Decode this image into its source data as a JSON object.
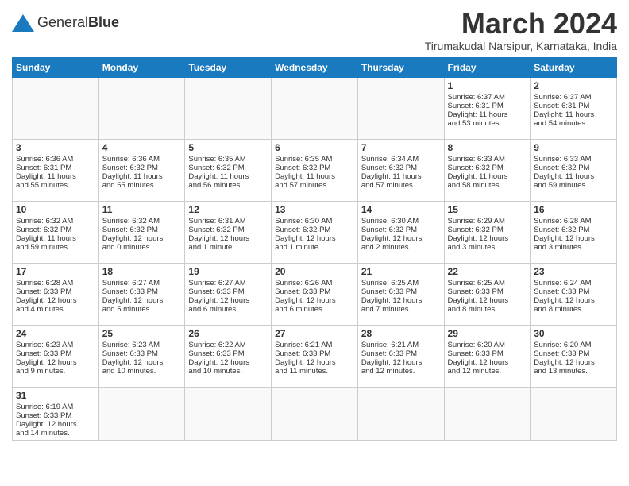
{
  "header": {
    "logo_text_normal": "General",
    "logo_text_bold": "Blue",
    "month_year": "March 2024",
    "location": "Tirumakudal Narsipur, Karnataka, India"
  },
  "days_of_week": [
    "Sunday",
    "Monday",
    "Tuesday",
    "Wednesday",
    "Thursday",
    "Friday",
    "Saturday"
  ],
  "weeks": [
    [
      {
        "day": "",
        "info": ""
      },
      {
        "day": "",
        "info": ""
      },
      {
        "day": "",
        "info": ""
      },
      {
        "day": "",
        "info": ""
      },
      {
        "day": "",
        "info": ""
      },
      {
        "day": "1",
        "info": "Sunrise: 6:37 AM\nSunset: 6:31 PM\nDaylight: 11 hours\nand 53 minutes."
      },
      {
        "day": "2",
        "info": "Sunrise: 6:37 AM\nSunset: 6:31 PM\nDaylight: 11 hours\nand 54 minutes."
      }
    ],
    [
      {
        "day": "3",
        "info": "Sunrise: 6:36 AM\nSunset: 6:31 PM\nDaylight: 11 hours\nand 55 minutes."
      },
      {
        "day": "4",
        "info": "Sunrise: 6:36 AM\nSunset: 6:32 PM\nDaylight: 11 hours\nand 55 minutes."
      },
      {
        "day": "5",
        "info": "Sunrise: 6:35 AM\nSunset: 6:32 PM\nDaylight: 11 hours\nand 56 minutes."
      },
      {
        "day": "6",
        "info": "Sunrise: 6:35 AM\nSunset: 6:32 PM\nDaylight: 11 hours\nand 57 minutes."
      },
      {
        "day": "7",
        "info": "Sunrise: 6:34 AM\nSunset: 6:32 PM\nDaylight: 11 hours\nand 57 minutes."
      },
      {
        "day": "8",
        "info": "Sunrise: 6:33 AM\nSunset: 6:32 PM\nDaylight: 11 hours\nand 58 minutes."
      },
      {
        "day": "9",
        "info": "Sunrise: 6:33 AM\nSunset: 6:32 PM\nDaylight: 11 hours\nand 59 minutes."
      }
    ],
    [
      {
        "day": "10",
        "info": "Sunrise: 6:32 AM\nSunset: 6:32 PM\nDaylight: 11 hours\nand 59 minutes."
      },
      {
        "day": "11",
        "info": "Sunrise: 6:32 AM\nSunset: 6:32 PM\nDaylight: 12 hours\nand 0 minutes."
      },
      {
        "day": "12",
        "info": "Sunrise: 6:31 AM\nSunset: 6:32 PM\nDaylight: 12 hours\nand 1 minute."
      },
      {
        "day": "13",
        "info": "Sunrise: 6:30 AM\nSunset: 6:32 PM\nDaylight: 12 hours\nand 1 minute."
      },
      {
        "day": "14",
        "info": "Sunrise: 6:30 AM\nSunset: 6:32 PM\nDaylight: 12 hours\nand 2 minutes."
      },
      {
        "day": "15",
        "info": "Sunrise: 6:29 AM\nSunset: 6:32 PM\nDaylight: 12 hours\nand 3 minutes."
      },
      {
        "day": "16",
        "info": "Sunrise: 6:28 AM\nSunset: 6:32 PM\nDaylight: 12 hours\nand 3 minutes."
      }
    ],
    [
      {
        "day": "17",
        "info": "Sunrise: 6:28 AM\nSunset: 6:33 PM\nDaylight: 12 hours\nand 4 minutes."
      },
      {
        "day": "18",
        "info": "Sunrise: 6:27 AM\nSunset: 6:33 PM\nDaylight: 12 hours\nand 5 minutes."
      },
      {
        "day": "19",
        "info": "Sunrise: 6:27 AM\nSunset: 6:33 PM\nDaylight: 12 hours\nand 6 minutes."
      },
      {
        "day": "20",
        "info": "Sunrise: 6:26 AM\nSunset: 6:33 PM\nDaylight: 12 hours\nand 6 minutes."
      },
      {
        "day": "21",
        "info": "Sunrise: 6:25 AM\nSunset: 6:33 PM\nDaylight: 12 hours\nand 7 minutes."
      },
      {
        "day": "22",
        "info": "Sunrise: 6:25 AM\nSunset: 6:33 PM\nDaylight: 12 hours\nand 8 minutes."
      },
      {
        "day": "23",
        "info": "Sunrise: 6:24 AM\nSunset: 6:33 PM\nDaylight: 12 hours\nand 8 minutes."
      }
    ],
    [
      {
        "day": "24",
        "info": "Sunrise: 6:23 AM\nSunset: 6:33 PM\nDaylight: 12 hours\nand 9 minutes."
      },
      {
        "day": "25",
        "info": "Sunrise: 6:23 AM\nSunset: 6:33 PM\nDaylight: 12 hours\nand 10 minutes."
      },
      {
        "day": "26",
        "info": "Sunrise: 6:22 AM\nSunset: 6:33 PM\nDaylight: 12 hours\nand 10 minutes."
      },
      {
        "day": "27",
        "info": "Sunrise: 6:21 AM\nSunset: 6:33 PM\nDaylight: 12 hours\nand 11 minutes."
      },
      {
        "day": "28",
        "info": "Sunrise: 6:21 AM\nSunset: 6:33 PM\nDaylight: 12 hours\nand 12 minutes."
      },
      {
        "day": "29",
        "info": "Sunrise: 6:20 AM\nSunset: 6:33 PM\nDaylight: 12 hours\nand 12 minutes."
      },
      {
        "day": "30",
        "info": "Sunrise: 6:20 AM\nSunset: 6:33 PM\nDaylight: 12 hours\nand 13 minutes."
      }
    ],
    [
      {
        "day": "31",
        "info": "Sunrise: 6:19 AM\nSunset: 6:33 PM\nDaylight: 12 hours\nand 14 minutes."
      },
      {
        "day": "",
        "info": ""
      },
      {
        "day": "",
        "info": ""
      },
      {
        "day": "",
        "info": ""
      },
      {
        "day": "",
        "info": ""
      },
      {
        "day": "",
        "info": ""
      },
      {
        "day": "",
        "info": ""
      }
    ]
  ]
}
